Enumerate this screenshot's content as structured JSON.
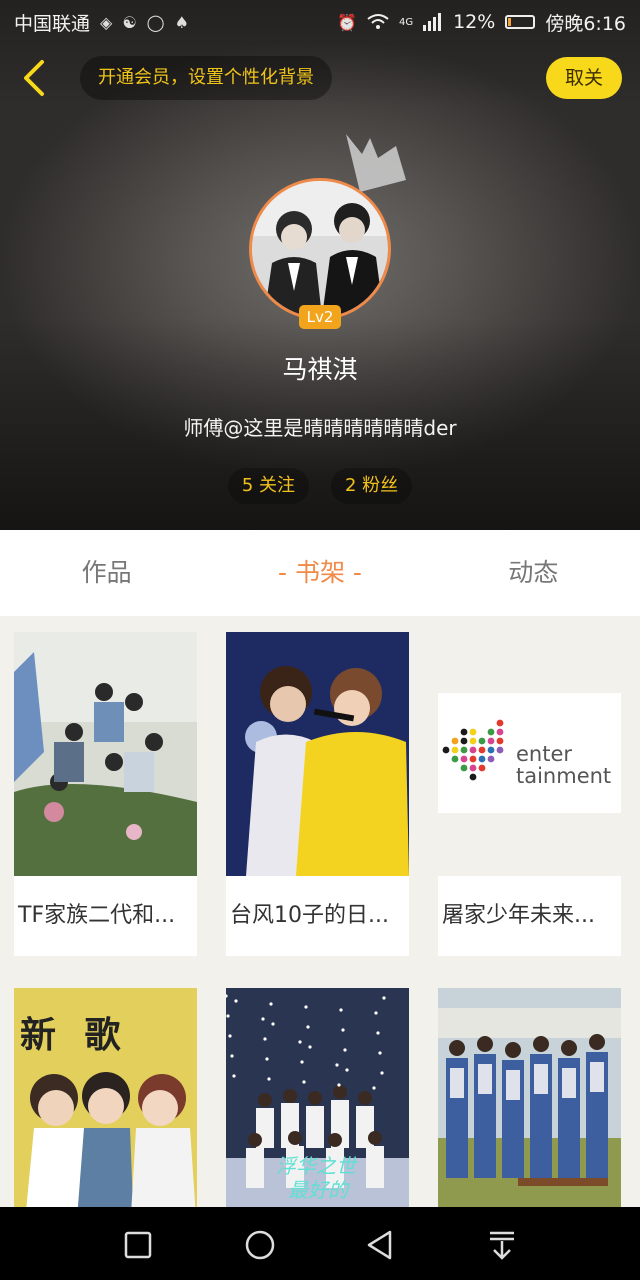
{
  "status_bar": {
    "carrier": "中国联通",
    "battery_percent": "12%",
    "time": "傍晚6:16",
    "network": "4G",
    "battery_level": 0.12
  },
  "topbar": {
    "vip_banner": "开通会员，设置个性化背景",
    "follow_button": "取关"
  },
  "profile": {
    "level": "Lv2",
    "name": "马祺淇",
    "bio": "师傅@这里是晴晴晴晴晴晴der",
    "following": "5 关注",
    "followers": "2 粉丝"
  },
  "tabs": [
    {
      "label": "作品"
    },
    {
      "label": "- 书架 -"
    },
    {
      "label": "动态"
    }
  ],
  "books": [
    {
      "title": "TF家族二代和..."
    },
    {
      "title": "台风10子的日..."
    },
    {
      "title": "屠家少年未来..."
    },
    {
      "title": ""
    },
    {
      "title": ""
    },
    {
      "title": ""
    }
  ],
  "logo_text": {
    "line1": "enter",
    "line2": "tainment"
  },
  "cover_text": {
    "card4": "新 歌",
    "card5a": "浮华之世",
    "card5b": "最好的"
  },
  "colors": {
    "accent": "#f08a48",
    "yellow": "#f8d81b",
    "gold_text": "#f2c21b"
  }
}
